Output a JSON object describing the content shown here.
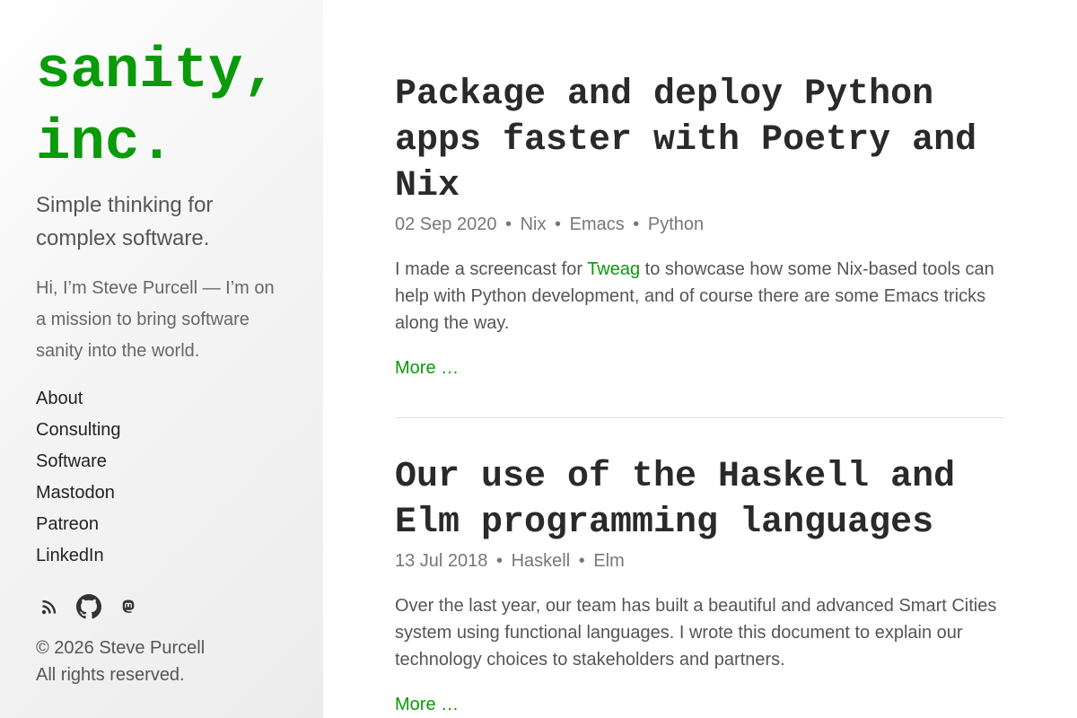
{
  "colors": {
    "accent": "#0a9a0a"
  },
  "sidebar": {
    "title_line1": "sanity,",
    "title_line2": "inc.",
    "tagline": "Simple thinking for complex software.",
    "intro": "Hi, I’m Steve Purcell — I’m on a mission to bring software sanity into the world.",
    "nav": [
      {
        "label": "About"
      },
      {
        "label": "Consulting"
      },
      {
        "label": "Software"
      },
      {
        "label": "Mastodon"
      },
      {
        "label": "Patreon"
      },
      {
        "label": "LinkedIn"
      }
    ],
    "social_icons": [
      "rss-icon",
      "github-icon",
      "mastodon-icon"
    ],
    "copyright_line1": "© 2026 Steve Purcell",
    "copyright_line2": "All rights reserved."
  },
  "posts": [
    {
      "title": "Package and deploy Python apps faster with Poetry and Nix",
      "date": "02 Sep 2020",
      "tags": [
        "Nix",
        "Emacs",
        "Python"
      ],
      "body_before_link": "I made a screencast for ",
      "body_link": "Tweag",
      "body_after_link": " to showcase how some Nix-based tools can help with Python development, and of course there are some Emacs tricks along the way.",
      "more_label": "More …"
    },
    {
      "title": "Our use of the Haskell and Elm programming languages",
      "date": "13 Jul 2018",
      "tags": [
        "Haskell",
        "Elm"
      ],
      "body": "Over the last year, our team has built a beautiful and advanced Smart Cities system using functional languages. I wrote this document to explain our technology choices to stakeholders and partners.",
      "more_label": "More …"
    }
  ]
}
